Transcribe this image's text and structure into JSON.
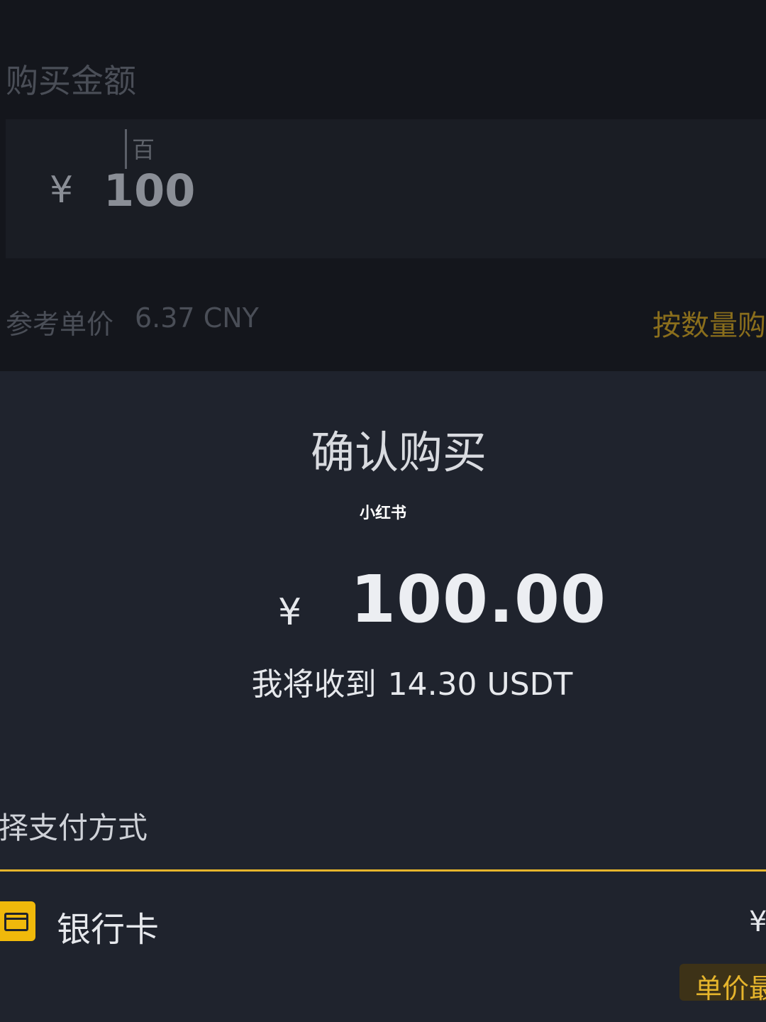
{
  "background_form": {
    "title": "购买金额",
    "amount_unit_hint": "百",
    "currency_symbol": "¥",
    "amount_value": "100",
    "reference_price_label": "参考单价",
    "reference_price_value": "6.37 CNY",
    "buy_by_quantity_link": "按数量购"
  },
  "confirm_sheet": {
    "title": "确认购买",
    "watermark": "小红书",
    "currency_symbol": "¥",
    "amount": "100.00",
    "receive_label": "我将收到",
    "receive_amount": "14.30 USDT",
    "payment_heading": "择支付方式",
    "payment_option": {
      "icon": "bank-card-icon",
      "label": "银行卡",
      "amount": "¥",
      "badge": "单价最"
    }
  },
  "colors": {
    "accent": "#f0b90b",
    "sheet_background": "#1f232d",
    "form_background": "#14161c"
  }
}
